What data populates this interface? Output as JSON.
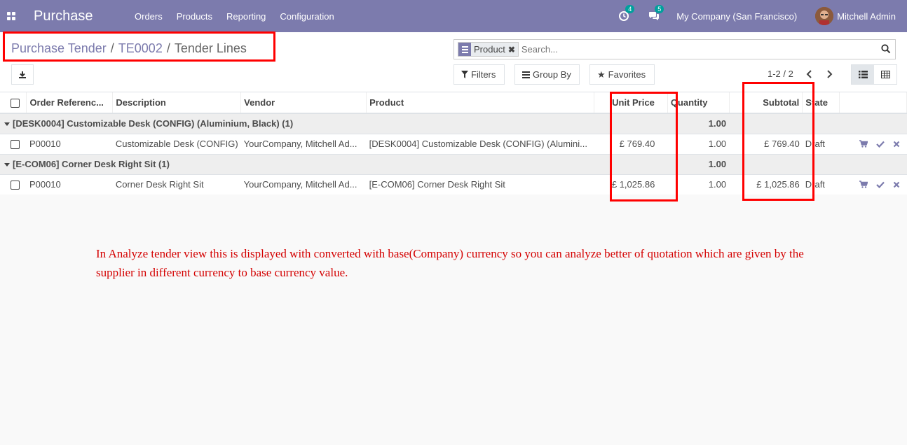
{
  "navbar": {
    "brand": "Purchase",
    "menu": [
      "Orders",
      "Products",
      "Reporting",
      "Configuration"
    ],
    "activity_count": "4",
    "message_count": "5",
    "company": "My Company (San Francisco)",
    "user": "Mitchell Admin"
  },
  "breadcrumb": {
    "level1": "Purchase Tender",
    "level2": "TE0002",
    "current": "Tender Lines",
    "separator": "/"
  },
  "search": {
    "facet_label": "Product",
    "placeholder": "Search..."
  },
  "buttons": {
    "filters": "Filters",
    "group_by": "Group By",
    "favorites": "Favorites"
  },
  "pager": {
    "text": "1-2 / 2"
  },
  "table": {
    "headers": {
      "order_reference": "Order Referenc...",
      "description": "Description",
      "vendor": "Vendor",
      "product": "Product",
      "unit_price": "Unit Price",
      "quantity": "Quantity",
      "subtotal": "Subtotal",
      "state": "State"
    },
    "groups": [
      {
        "label": "[DESK0004] Customizable Desk (CONFIG) (Aluminium, Black) (1)",
        "quantity": "1.00",
        "row": {
          "order_reference": "P00010",
          "description": "Customizable Desk (CONFIG)",
          "vendor": "YourCompany, Mitchell Ad...",
          "product": "[DESK0004] Customizable Desk (CONFIG) (Alumini...",
          "unit_price": "£ 769.40",
          "quantity": "1.00",
          "subtotal": "£ 769.40",
          "state": "Draft"
        }
      },
      {
        "label": "[E-COM06] Corner Desk Right Sit (1)",
        "quantity": "1.00",
        "row": {
          "order_reference": "P00010",
          "description": "Corner Desk Right Sit",
          "vendor": "YourCompany, Mitchell Ad...",
          "product": "[E-COM06] Corner Desk Right Sit",
          "unit_price": "£ 1,025.86",
          "quantity": "1.00",
          "subtotal": "£ 1,025.86",
          "state": "Draft"
        }
      }
    ]
  },
  "annotation": {
    "note": "In Analyze tender view this is displayed with converted with base(Company) currency so you can analyze better of quotation which are given by the supplier in different currency to base currency value.",
    "color": "#d40000"
  },
  "colors": {
    "brand": "#7c7bad",
    "highlight_box": "#ff0000"
  }
}
